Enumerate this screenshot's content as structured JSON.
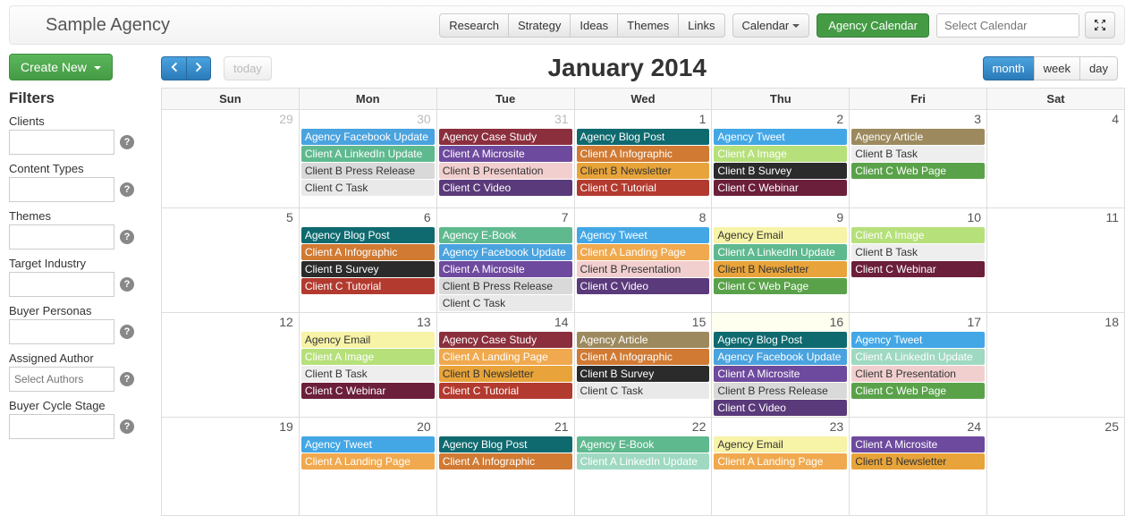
{
  "brand": "Sample Agency",
  "topnav": {
    "tabs": [
      "Research",
      "Strategy",
      "Ideas",
      "Themes",
      "Links"
    ],
    "calendar_btn": "Calendar",
    "badge": "Agency Calendar",
    "select_placeholder": "Select Calendar"
  },
  "sidebar": {
    "create": "Create New",
    "filters_heading": "Filters",
    "filters": [
      {
        "label": "Clients",
        "placeholder": ""
      },
      {
        "label": "Content Types",
        "placeholder": ""
      },
      {
        "label": "Themes",
        "placeholder": ""
      },
      {
        "label": "Target Industry",
        "placeholder": ""
      },
      {
        "label": "Buyer Personas",
        "placeholder": ""
      },
      {
        "label": "Assigned Author",
        "placeholder": "Select Authors"
      },
      {
        "label": "Buyer Cycle Stage",
        "placeholder": ""
      }
    ]
  },
  "calendar": {
    "today": "today",
    "title": "January 2014",
    "views": [
      "month",
      "week",
      "day"
    ],
    "active_view": "month",
    "dow": [
      "Sun",
      "Mon",
      "Tue",
      "Wed",
      "Thu",
      "Fri",
      "Sat"
    ],
    "colors": {
      "afb": "#4aa3df",
      "acs": "#8b2f3d",
      "abp": "#0f6a6f",
      "atw": "#43a7e6",
      "aart": "#9c8a5e",
      "ali": "#5fb98f",
      "amic": "#6e4a9e",
      "ainf": "#d07a33",
      "aimg": "#b6e07a",
      "ctask": "#e5e5e5",
      "cbpr": "#d0d0d0",
      "cbpres": "#f2cfcf",
      "cbnl": "#e8a43a",
      "cbtut": "#b4b4b4",
      "ccv": "#5a3a7a",
      "cbs": "#2b2b2b",
      "cct": "#b33a2f",
      "ccw": "#6b1f3a",
      "aeb": "#5fb98f",
      "alp": "#f0a94e",
      "aem": "#f7f3a7",
      "ccwp": "#5aa24a",
      "cbt": "#eee",
      "cbt_tx": "#333",
      "ali2": "#9fd9c2"
    },
    "weeks": [
      {
        "days": [
          {
            "n": "29",
            "other": true,
            "ev": []
          },
          {
            "n": "30",
            "other": true,
            "ev": [
              {
                "t": "Agency Facebook Update",
                "bg": "#4aa3df",
                "fg": "#fff"
              },
              {
                "t": "Client A LinkedIn Update",
                "bg": "#5fb98f",
                "fg": "#fff"
              },
              {
                "t": "Client B Press Release",
                "bg": "#d9d9d9",
                "fg": "#333"
              },
              {
                "t": "Client C Task",
                "bg": "#e9e9e9",
                "fg": "#333"
              }
            ]
          },
          {
            "n": "31",
            "other": true,
            "ev": [
              {
                "t": "Agency Case Study",
                "bg": "#8b2f3d",
                "fg": "#fff"
              },
              {
                "t": "Client A Microsite",
                "bg": "#6e4a9e",
                "fg": "#fff"
              },
              {
                "t": "Client B Presentation",
                "bg": "#f2cfcf",
                "fg": "#333"
              },
              {
                "t": "Client C Video",
                "bg": "#5a3a7a",
                "fg": "#fff"
              }
            ]
          },
          {
            "n": "1",
            "ev": [
              {
                "t": "Agency Blog Post",
                "bg": "#0f6a6f",
                "fg": "#fff"
              },
              {
                "t": "Client A Infographic",
                "bg": "#d07a33",
                "fg": "#fff"
              },
              {
                "t": "Client B Newsletter",
                "bg": "#e8a43a",
                "fg": "#333"
              },
              {
                "t": "Client C Tutorial",
                "bg": "#b33a2f",
                "fg": "#fff"
              }
            ]
          },
          {
            "n": "2",
            "ev": [
              {
                "t": "Agency Tweet",
                "bg": "#43a7e6",
                "fg": "#fff"
              },
              {
                "t": "Client A Image",
                "bg": "#b6e07a",
                "fg": "#fff"
              },
              {
                "t": "Client B Survey",
                "bg": "#2b2b2b",
                "fg": "#fff"
              },
              {
                "t": "Client C Webinar",
                "bg": "#6b1f3a",
                "fg": "#fff"
              }
            ]
          },
          {
            "n": "3",
            "ev": [
              {
                "t": "Agency Article",
                "bg": "#9c8a5e",
                "fg": "#fff"
              },
              {
                "t": "Client B Task",
                "bg": "#eee",
                "fg": "#333"
              },
              {
                "t": "Client C Web Page",
                "bg": "#5aa24a",
                "fg": "#fff"
              }
            ]
          },
          {
            "n": "4",
            "ev": []
          }
        ]
      },
      {
        "days": [
          {
            "n": "5",
            "ev": []
          },
          {
            "n": "6",
            "ev": [
              {
                "t": "Agency Blog Post",
                "bg": "#0f6a6f",
                "fg": "#fff"
              },
              {
                "t": "Client A Infographic",
                "bg": "#d07a33",
                "fg": "#fff"
              },
              {
                "t": "Client B Survey",
                "bg": "#2b2b2b",
                "fg": "#fff"
              },
              {
                "t": "Client C Tutorial",
                "bg": "#b33a2f",
                "fg": "#fff"
              }
            ]
          },
          {
            "n": "7",
            "ev": [
              {
                "t": "Agency E-Book",
                "bg": "#5fb98f",
                "fg": "#fff"
              },
              {
                "t": "Agency Facebook Update",
                "bg": "#4aa3df",
                "fg": "#fff"
              },
              {
                "t": "Client A Microsite",
                "bg": "#6e4a9e",
                "fg": "#fff"
              },
              {
                "t": "Client B Press Release",
                "bg": "#d9d9d9",
                "fg": "#333"
              },
              {
                "t": "Client C Task",
                "bg": "#e9e9e9",
                "fg": "#333"
              }
            ]
          },
          {
            "n": "8",
            "ev": [
              {
                "t": "Agency Tweet",
                "bg": "#43a7e6",
                "fg": "#fff"
              },
              {
                "t": "Client A Landing Page",
                "bg": "#f0a94e",
                "fg": "#fff"
              },
              {
                "t": "Client B Presentation",
                "bg": "#f2cfcf",
                "fg": "#333"
              },
              {
                "t": "Client C Video",
                "bg": "#5a3a7a",
                "fg": "#fff"
              }
            ]
          },
          {
            "n": "9",
            "ev": [
              {
                "t": "Agency Email",
                "bg": "#f7f3a7",
                "fg": "#333"
              },
              {
                "t": "Client A LinkedIn Update",
                "bg": "#5fb98f",
                "fg": "#fff"
              },
              {
                "t": "Client B Newsletter",
                "bg": "#e8a43a",
                "fg": "#333"
              },
              {
                "t": "Client C Web Page",
                "bg": "#5aa24a",
                "fg": "#fff"
              }
            ]
          },
          {
            "n": "10",
            "ev": [
              {
                "t": "Client A Image",
                "bg": "#b6e07a",
                "fg": "#fff"
              },
              {
                "t": "Client B Task",
                "bg": "#eee",
                "fg": "#333"
              },
              {
                "t": "Client C Webinar",
                "bg": "#6b1f3a",
                "fg": "#fff"
              }
            ]
          },
          {
            "n": "11",
            "ev": []
          }
        ]
      },
      {
        "days": [
          {
            "n": "12",
            "ev": []
          },
          {
            "n": "13",
            "ev": [
              {
                "t": "Agency Email",
                "bg": "#f7f3a7",
                "fg": "#333"
              },
              {
                "t": "Client A Image",
                "bg": "#b6e07a",
                "fg": "#fff"
              },
              {
                "t": "Client B Task",
                "bg": "#eee",
                "fg": "#333"
              },
              {
                "t": "Client C Webinar",
                "bg": "#6b1f3a",
                "fg": "#fff"
              }
            ]
          },
          {
            "n": "14",
            "ev": [
              {
                "t": "Agency Case Study",
                "bg": "#8b2f3d",
                "fg": "#fff"
              },
              {
                "t": "Client A Landing Page",
                "bg": "#f0a94e",
                "fg": "#fff"
              },
              {
                "t": "Client B Newsletter",
                "bg": "#e8a43a",
                "fg": "#333"
              },
              {
                "t": "Client C Tutorial",
                "bg": "#b33a2f",
                "fg": "#fff"
              }
            ]
          },
          {
            "n": "15",
            "ev": [
              {
                "t": "Agency Article",
                "bg": "#9c8a5e",
                "fg": "#fff"
              },
              {
                "t": "Client A Infographic",
                "bg": "#d07a33",
                "fg": "#fff"
              },
              {
                "t": "Client B Survey",
                "bg": "#2b2b2b",
                "fg": "#fff"
              },
              {
                "t": "Client C Task",
                "bg": "#e9e9e9",
                "fg": "#333"
              }
            ]
          },
          {
            "n": "16",
            "hl": true,
            "ev": [
              {
                "t": "Agency Blog Post",
                "bg": "#0f6a6f",
                "fg": "#fff"
              },
              {
                "t": "Agency Facebook Update",
                "bg": "#4aa3df",
                "fg": "#fff"
              },
              {
                "t": "Client A Microsite",
                "bg": "#6e4a9e",
                "fg": "#fff"
              },
              {
                "t": "Client B Press Release",
                "bg": "#d9d9d9",
                "fg": "#333"
              },
              {
                "t": "Client C Video",
                "bg": "#5a3a7a",
                "fg": "#fff"
              }
            ]
          },
          {
            "n": "17",
            "ev": [
              {
                "t": "Agency Tweet",
                "bg": "#43a7e6",
                "fg": "#fff"
              },
              {
                "t": "Client A LinkedIn Update",
                "bg": "#9fd9c2",
                "fg": "#fff"
              },
              {
                "t": "Client B Presentation",
                "bg": "#f2cfcf",
                "fg": "#333"
              },
              {
                "t": "Client C Web Page",
                "bg": "#5aa24a",
                "fg": "#fff"
              }
            ]
          },
          {
            "n": "18",
            "ev": []
          }
        ]
      },
      {
        "days": [
          {
            "n": "19",
            "ev": []
          },
          {
            "n": "20",
            "ev": [
              {
                "t": "Agency Tweet",
                "bg": "#43a7e6",
                "fg": "#fff"
              },
              {
                "t": "Client A Landing Page",
                "bg": "#f0a94e",
                "fg": "#fff"
              }
            ]
          },
          {
            "n": "21",
            "ev": [
              {
                "t": "Agency Blog Post",
                "bg": "#0f6a6f",
                "fg": "#fff"
              },
              {
                "t": "Client A Infographic",
                "bg": "#d07a33",
                "fg": "#fff"
              }
            ]
          },
          {
            "n": "22",
            "ev": [
              {
                "t": "Agency E-Book",
                "bg": "#5fb98f",
                "fg": "#fff"
              },
              {
                "t": "Client A LinkedIn Update",
                "bg": "#9fd9c2",
                "fg": "#fff"
              }
            ]
          },
          {
            "n": "23",
            "ev": [
              {
                "t": "Agency Email",
                "bg": "#f7f3a7",
                "fg": "#333"
              },
              {
                "t": "Client A Landing Page",
                "bg": "#f0a94e",
                "fg": "#fff"
              }
            ]
          },
          {
            "n": "24",
            "ev": [
              {
                "t": "Client A Microsite",
                "bg": "#6e4a9e",
                "fg": "#fff"
              },
              {
                "t": "Client B Newsletter",
                "bg": "#e8a43a",
                "fg": "#333"
              }
            ]
          },
          {
            "n": "25",
            "ev": []
          }
        ]
      }
    ]
  }
}
